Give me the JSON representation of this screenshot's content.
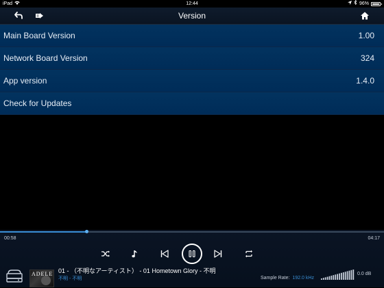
{
  "status_bar": {
    "device": "iPad",
    "time": "12:44",
    "battery": "96%"
  },
  "navbar": {
    "title": "Version"
  },
  "rows": [
    {
      "label": "Main Board Version",
      "value": "1.00"
    },
    {
      "label": "Network Board Version",
      "value": "324"
    },
    {
      "label": "App version",
      "value": "1.4.0"
    },
    {
      "label": "Check for Updates",
      "value": ""
    }
  ],
  "player": {
    "elapsed": "00:58",
    "duration": "04:17",
    "progress_fraction": 0.226,
    "track_title": "01 - （不明なアーティスト） - 01 Hometown Glory - 不明",
    "track_sub": "不明 - 不明",
    "album_art_text": "ADELE",
    "sample_rate_label": "Sample Rate:",
    "sample_rate_value": "192.0 kHz",
    "volume_db": "0.0 dB"
  },
  "colors": {
    "list_bg": "#003060",
    "accent": "#3a8fd6"
  }
}
